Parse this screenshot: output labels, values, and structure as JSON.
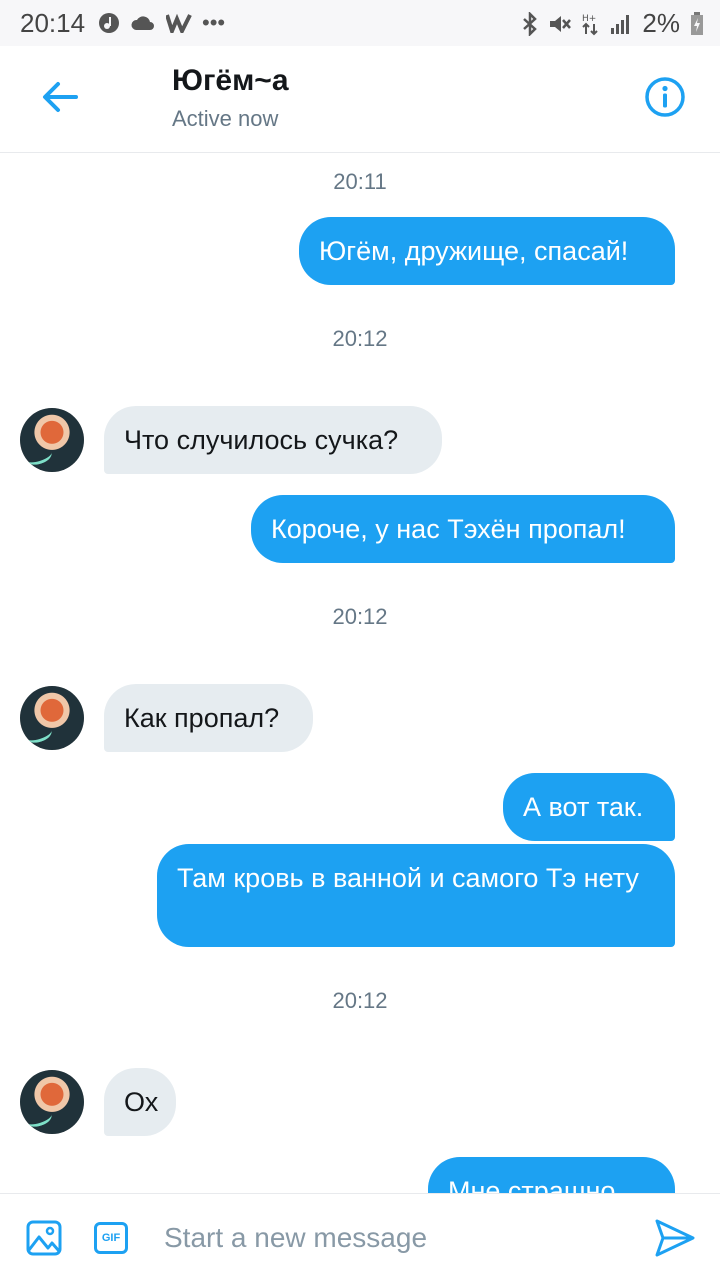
{
  "status_bar": {
    "time": "20:14",
    "left_icons": [
      "music-icon",
      "cloud-icon",
      "w-app-icon",
      "more-dots-icon"
    ],
    "right_icons": [
      "bluetooth-icon",
      "mute-icon",
      "data-icon",
      "signal-icon"
    ],
    "battery": "2%"
  },
  "header": {
    "title": "Югём~а",
    "subtitle": "Active now",
    "back_icon": "arrow-left-icon",
    "info_icon": "info-icon"
  },
  "messages": [
    {
      "type": "timestamp",
      "text": "20:11"
    },
    {
      "type": "outgoing",
      "text": "Югём, дружище, спасай!"
    },
    {
      "type": "timestamp",
      "text": "20:12"
    },
    {
      "type": "incoming",
      "text": "Что случилось сучка?"
    },
    {
      "type": "outgoing",
      "text": "Короче, у нас Тэхён пропал!"
    },
    {
      "type": "timestamp",
      "text": "20:12"
    },
    {
      "type": "incoming",
      "text": "Как пропал?"
    },
    {
      "type": "outgoing",
      "text": "А вот так."
    },
    {
      "type": "outgoing",
      "text": "Там кровь в ванной и самого Тэ нету"
    },
    {
      "type": "timestamp",
      "text": "20:12"
    },
    {
      "type": "incoming",
      "text": "Ох"
    },
    {
      "type": "outgoing",
      "text": "Мне страшно"
    }
  ],
  "composer": {
    "placeholder": "Start a new message",
    "gif_label": "GIF",
    "media_icon": "image-icon",
    "send_icon": "send-icon"
  },
  "colors": {
    "accent": "#1da1f2",
    "incoming_bubble": "#e6ecf0",
    "secondary_text": "#657786"
  }
}
